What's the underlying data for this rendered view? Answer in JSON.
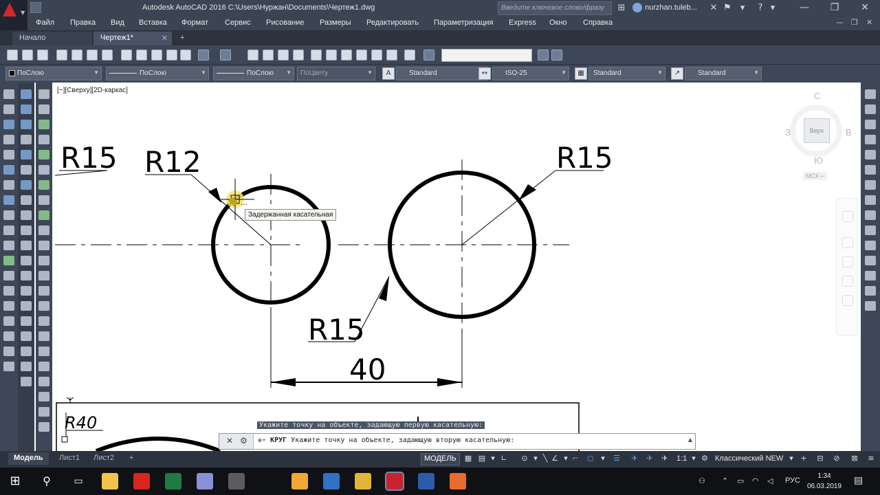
{
  "window": {
    "title": "Autodesk AutoCAD 2016    C:\\Users\\Нуржан\\Documents\\Чертеж1.dwg",
    "search_placeholder": "Введите ключевое слово/фразу",
    "user": "nurzhan.tuleb...",
    "controls": {
      "minimize": "—",
      "maximize": "❐",
      "close": "✕"
    }
  },
  "menu": {
    "items": [
      "Файл",
      "Правка",
      "Вид",
      "Вставка",
      "Формат",
      "Сервис",
      "Рисование",
      "Размеры",
      "Редактировать",
      "Параметризация",
      "Express",
      "Окно",
      "Справка"
    ]
  },
  "doc_tabs": {
    "start": "Начало",
    "active": "Чертеж1*",
    "close": "✕",
    "add": "+"
  },
  "properties": {
    "layer_color": "ПоСлою",
    "linetype": "ПоСлою",
    "lineweight": "ПоСлою",
    "plot_style": "ПоЦвету",
    "text_style": "Standard",
    "dim_style": "ISO-25",
    "table_style": "Standard",
    "mleader_style": "Standard"
  },
  "canvas": {
    "viewport_label": "[−][Сверху][2D-каркас]",
    "tooltip": "Задержанная касательная",
    "command_history": "Укажите точку на объекте, задающую первую касательную:",
    "cursor_marker": "...",
    "drawing": {
      "label_r15_left": "R15",
      "label_r12": "R12",
      "label_r15_right": "R15",
      "label_r15_bottom": "R15",
      "dimension_value": "40",
      "label_r40": "R40"
    },
    "viewcube": {
      "north": "С",
      "south": "Ю",
      "west": "З",
      "east": "В",
      "face": "Верх",
      "wcs": "МСК ⌐"
    }
  },
  "command_line": {
    "command": "КРУГ",
    "prompt": "Укажите точку на объекте, задающую вторую касательную:"
  },
  "status_bar": {
    "layouts": [
      "Модель",
      "Лист1",
      "Лист2"
    ],
    "add_layout": "+",
    "model_button": "МОДЕЛЬ",
    "scale": "1:1",
    "workspace": "Классический NEW"
  },
  "taskbar": {
    "language": "РУС",
    "time": "1:34",
    "date": "06.03.2019",
    "apps": [
      {
        "name": "explorer",
        "color": "#f2c24b"
      },
      {
        "name": "acrobat",
        "color": "#d6261d"
      },
      {
        "name": "excel",
        "color": "#1f7a44"
      },
      {
        "name": "paint",
        "color": "#8a8fd6"
      },
      {
        "name": "calculator",
        "color": "#5c5c5c"
      },
      {
        "name": "ibooks",
        "color": "#f2a633"
      },
      {
        "name": "app-round",
        "color": "#2f72c6"
      },
      {
        "name": "chrome",
        "color": "#e2b43a"
      },
      {
        "name": "autocad",
        "color": "#c8232c"
      },
      {
        "name": "word",
        "color": "#2b5caa"
      },
      {
        "name": "sketch",
        "color": "#e66d2e"
      }
    ]
  },
  "colors": {
    "chrome_dark": "#3b4453",
    "canvas_bg": "#ffffff",
    "drawing_ink": "#000000",
    "autocad_red": "#d8262b"
  }
}
